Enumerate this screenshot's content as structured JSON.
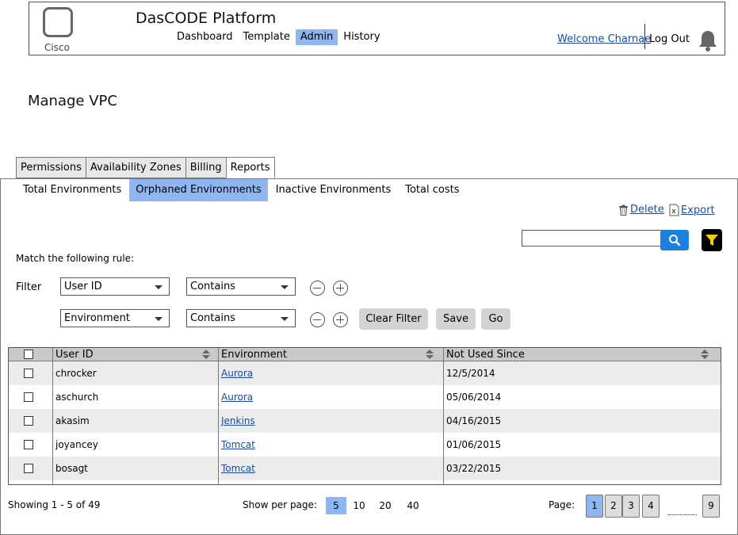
{
  "header": {
    "logo_text": "Cisco",
    "app_title": "DasCODE Platform",
    "nav": [
      {
        "label": "Dashboard",
        "active": false
      },
      {
        "label": "Template",
        "active": false
      },
      {
        "label": "Admin",
        "active": true
      },
      {
        "label": "History",
        "active": false
      }
    ],
    "welcome": "Welcome Charnae",
    "logout": "Log Out"
  },
  "page_title": "Manage VPC",
  "tabs": [
    {
      "label": "Permissions",
      "active": false
    },
    {
      "label": "Availability Zones",
      "active": false
    },
    {
      "label": "Billing",
      "active": false
    },
    {
      "label": "Reports",
      "active": true
    }
  ],
  "subtabs": [
    {
      "label": "Total Environments",
      "active": false
    },
    {
      "label": "Orphaned Environments",
      "active": true
    },
    {
      "label": "Inactive Environments",
      "active": false
    },
    {
      "label": "Total costs",
      "active": false
    }
  ],
  "actions": {
    "delete": "Delete",
    "export": "Export"
  },
  "search": {
    "value": ""
  },
  "filter": {
    "rule_label": "Match the following rule:",
    "label": "Filter",
    "rows": [
      {
        "field": "User ID",
        "operator": "Contains"
      },
      {
        "field": "Environment",
        "operator": "Contains"
      }
    ],
    "clear_label": "Clear Filter",
    "save_label": "Save",
    "go_label": "Go"
  },
  "table": {
    "columns": [
      "User ID",
      "Environment",
      "Not Used Since"
    ],
    "rows": [
      {
        "user": "chrocker",
        "env": "Aurora",
        "date": "12/5/2014"
      },
      {
        "user": "aschurch",
        "env": "Aurora",
        "date": "05/06/2014"
      },
      {
        "user": "akasim",
        "env": "Jenkins",
        "date": "04/16/2015"
      },
      {
        "user": "joyancey",
        "env": "Tomcat",
        "date": "01/06/2015"
      },
      {
        "user": "bosagt",
        "env": "Tomcat",
        "date": "03/22/2015"
      }
    ]
  },
  "footer": {
    "showing": "Showing 1 - 5 of 49",
    "per_page_label": "Show per page:",
    "per_page_options": [
      "5",
      "10",
      "20",
      "40"
    ],
    "per_page_selected": "5",
    "page_label": "Page:",
    "pages": [
      "1",
      "2",
      "3",
      "4"
    ],
    "last_page": "9",
    "current_page": "1"
  },
  "colors": {
    "accent": "#8fb6f0",
    "link": "#1a4b9c",
    "search_button": "#1d7fe0"
  }
}
